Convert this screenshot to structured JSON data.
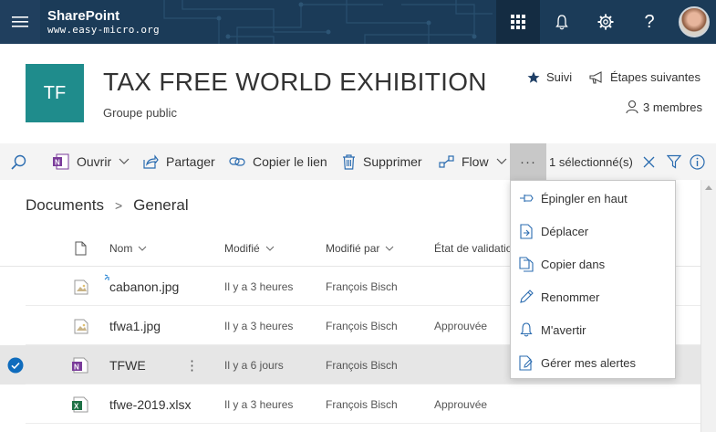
{
  "suite": {
    "brand": "SharePoint",
    "domain": "www.easy-micro.org",
    "help_glyph": "?",
    "icons": [
      "hamburger-icon",
      "app-launcher-icon",
      "bell-icon",
      "gear-icon",
      "help-icon"
    ],
    "colors": {
      "bar": "#1b3b58",
      "accent": "#1f8c8c"
    }
  },
  "site": {
    "logo_initials": "TF",
    "title": "TAX FREE WORLD EXHIBITION",
    "subtitle": "Groupe public",
    "follow_label": "Suivi",
    "next_steps_label": "Étapes suivantes",
    "members_label": "3 membres"
  },
  "command_bar": {
    "open_label": "Ouvrir",
    "share_label": "Partager",
    "copy_link_label": "Copier le lien",
    "delete_label": "Supprimer",
    "flow_label": "Flow",
    "more_glyph": "···",
    "selection_label": "1 sélectionné(s)"
  },
  "breadcrumb": {
    "root": "Documents",
    "separator": ">",
    "current": "General"
  },
  "list": {
    "columns": {
      "name": "Nom",
      "modified": "Modifié",
      "modified_by": "Modifié par",
      "status": "État de validatio"
    },
    "rows": [
      {
        "name": "cabanon.jpg",
        "modified": "Il y a 3 heures",
        "modified_by": "François Bisch",
        "status": "",
        "type": "image",
        "selected": false
      },
      {
        "name": "tfwa1.jpg",
        "modified": "Il y a 3 heures",
        "modified_by": "François Bisch",
        "status": "Approuvée",
        "type": "image",
        "selected": false
      },
      {
        "name": "TFWE",
        "modified": "Il y a 6 jours",
        "modified_by": "François Bisch",
        "status": "",
        "type": "onenote",
        "selected": true
      },
      {
        "name": "tfwe-2019.xlsx",
        "modified": "Il y a 3 heures",
        "modified_by": "François Bisch",
        "status": "Approuvée",
        "type": "excel",
        "selected": false
      }
    ],
    "row_more_glyph": "⋮"
  },
  "menu": {
    "items": [
      {
        "label": "Épingler en haut",
        "icon": "pin-icon"
      },
      {
        "label": "Déplacer",
        "icon": "move-icon"
      },
      {
        "label": "Copier dans",
        "icon": "copy-icon"
      },
      {
        "label": "Renommer",
        "icon": "rename-icon"
      },
      {
        "label": "M'avertir",
        "icon": "bell-icon"
      },
      {
        "label": "Gérer mes alertes",
        "icon": "manage-alerts-icon"
      }
    ]
  }
}
